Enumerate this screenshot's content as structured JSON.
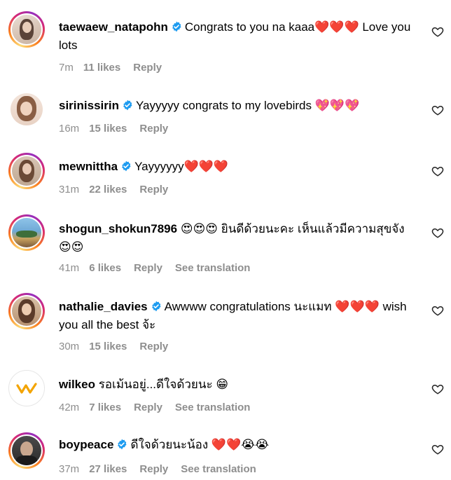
{
  "comments": [
    {
      "username": "taewaew_natapohn",
      "verified": true,
      "text": "Congrats to you na kaaa❤️❤️❤️ Love you lots",
      "time": "7m",
      "likes": "11 likes",
      "reply": "Reply",
      "translation": ""
    },
    {
      "username": "sirinissirin",
      "verified": true,
      "text": "Yayyyyy congrats to my lovebirds 💖💖💖",
      "time": "16m",
      "likes": "15 likes",
      "reply": "Reply",
      "translation": ""
    },
    {
      "username": "mewnittha",
      "verified": true,
      "text": "Yayyyyyy❤️❤️❤️",
      "time": "31m",
      "likes": "22 likes",
      "reply": "Reply",
      "translation": ""
    },
    {
      "username": "shogun_shokun7896",
      "verified": false,
      "text": "😍😍😍 ยินดีด้วยนะคะ เห็นแล้วมีความสุขจัง 😍😍",
      "time": "41m",
      "likes": "6 likes",
      "reply": "Reply",
      "translation": "See translation"
    },
    {
      "username": "nathalie_davies",
      "verified": true,
      "text": "Awwww congratulations นะแมท ❤️❤️❤️ wish you all the best จ้ะ",
      "time": "30m",
      "likes": "15 likes",
      "reply": "Reply",
      "translation": ""
    },
    {
      "username": "wilkeo",
      "verified": false,
      "text": "รอเม้นอยู่...ดีใจด้วยนะ 😁",
      "time": "42m",
      "likes": "7 likes",
      "reply": "Reply",
      "translation": "See translation"
    },
    {
      "username": "boypeace",
      "verified": true,
      "text": "ดีใจด้วยนะน้อง ❤️❤️😭😭",
      "time": "37m",
      "likes": "27 likes",
      "reply": "Reply",
      "translation": "See translation"
    }
  ],
  "icons": {
    "like": "heart-outline-icon",
    "verified": "verified-badge-icon"
  },
  "colors": {
    "verified": "#1d9bf0",
    "meta": "#8e8e8e"
  }
}
